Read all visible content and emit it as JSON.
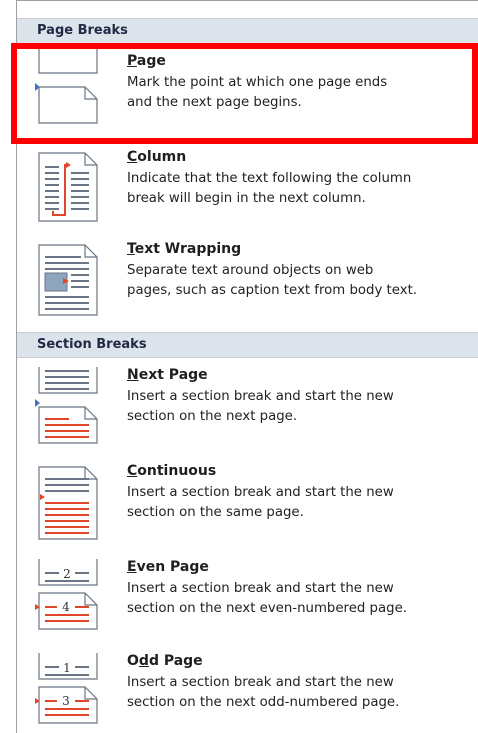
{
  "sections": {
    "page_breaks": {
      "label": "Page Breaks"
    },
    "section_breaks": {
      "label": "Section Breaks"
    }
  },
  "items": [
    {
      "key": "P",
      "rest": "age",
      "desc": "Mark the point at which one page ends\nand the next page begins."
    },
    {
      "key": "C",
      "rest": "olumn",
      "desc": "Indicate that the text following the column\nbreak will begin in the next column."
    },
    {
      "key": "T",
      "rest": "ext Wrapping",
      "desc": "Separate text around objects on web\npages, such as caption text from body text."
    },
    {
      "key": "N",
      "rest": "ext Page",
      "desc": "Insert a section break and start the new\nsection on the next page."
    },
    {
      "key": "C",
      "rest": "ontinuous",
      "desc": "Insert a section break and start the new\nsection on the same page."
    },
    {
      "key": "E",
      "rest": "ven Page",
      "desc": "Insert a section break and start the new\nsection on the next even-numbered page."
    },
    {
      "pre": "O",
      "key": "d",
      "rest": "d Page",
      "desc": "Insert a section break and start the new\nsection on the next odd-numbered page."
    }
  ],
  "icon_numbers": {
    "even_top": "2",
    "even_bottom": "4",
    "odd_top": "1",
    "odd_bottom": "3"
  },
  "colors": {
    "highlight": "#ff0000",
    "header_bg": "#dde3ea",
    "accent": "#4472c4",
    "break_red": "#e0462a"
  }
}
